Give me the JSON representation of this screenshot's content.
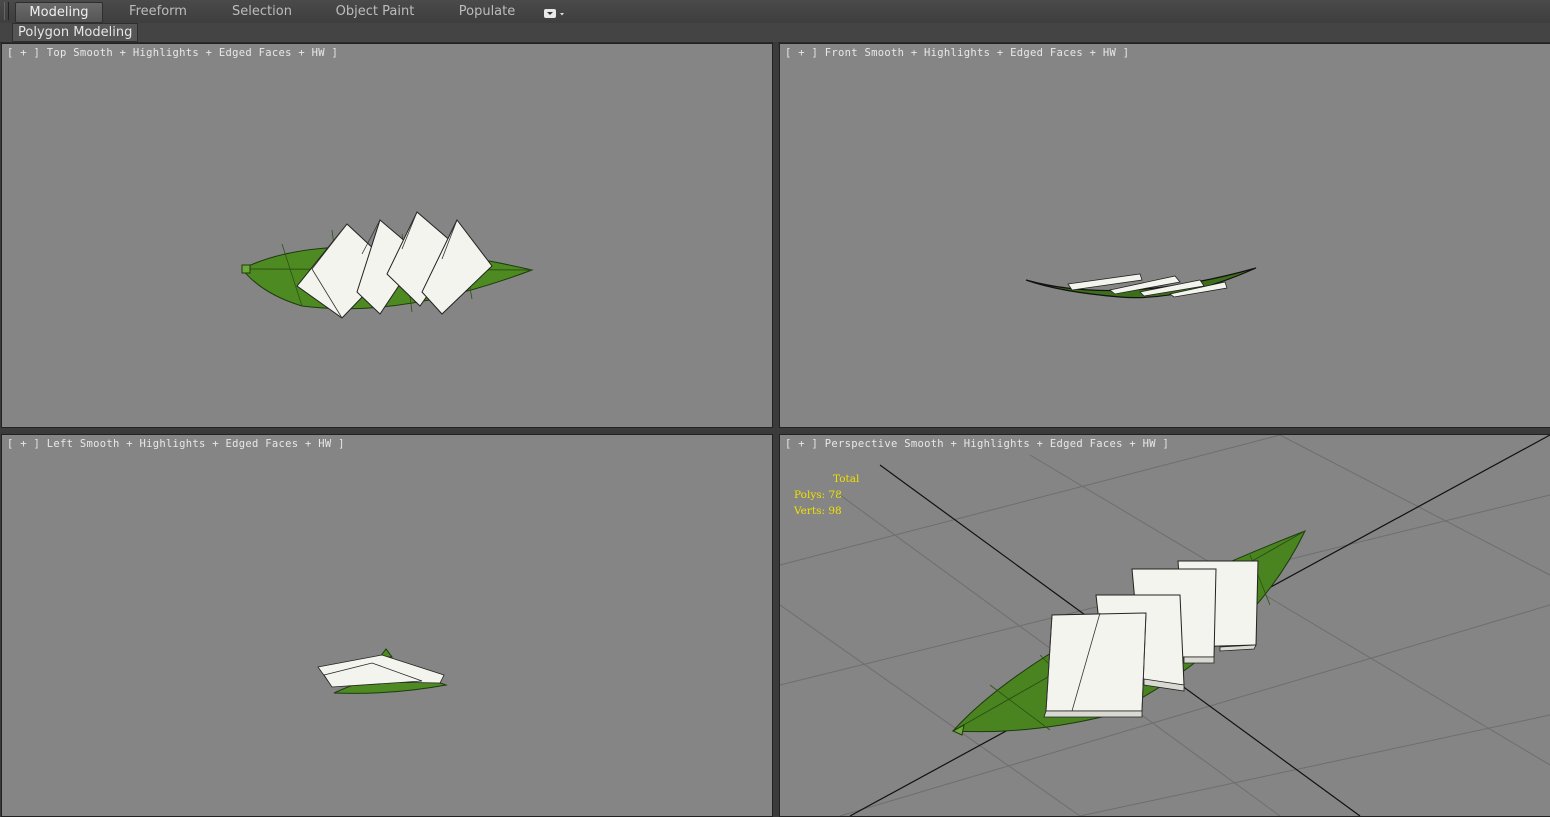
{
  "ribbon": {
    "tabs": [
      {
        "label": "Modeling",
        "active": true
      },
      {
        "label": "Freeform",
        "active": false
      },
      {
        "label": "Selection",
        "active": false
      },
      {
        "label": "Object Paint",
        "active": false
      },
      {
        "label": "Populate",
        "active": false
      }
    ],
    "panel_label": "Polygon Modeling",
    "dropdown_icon": "dropdown-arrow-icon"
  },
  "viewports": {
    "top": {
      "plus": "[ + ]",
      "name": "Top",
      "shading": "Smooth + Highlights + Edged Faces + HW ]"
    },
    "front": {
      "plus": "[ + ]",
      "name": "Front",
      "shading": "Smooth + Highlights + Edged Faces + HW ]"
    },
    "left": {
      "plus": "[ + ]",
      "name": "Left",
      "shading": "Smooth + Highlights + Edged Faces + HW ]"
    },
    "perspective": {
      "plus": "[ + ]",
      "name": "Perspective",
      "shading": "Smooth + Highlights + Edged Faces + HW ]"
    }
  },
  "stats": {
    "title": "Total",
    "polys_label": "Polys:",
    "polys_value": "78",
    "verts_label": "Verts:",
    "verts_value": "98"
  },
  "colors": {
    "viewport_bg": "#858585",
    "leaf": "#4e8a22",
    "tofu": "#f2f2ea",
    "stats_text": "#f0e000"
  }
}
